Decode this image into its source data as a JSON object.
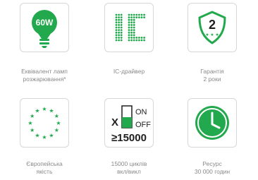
{
  "colors": {
    "green": "#23a94d",
    "dark": "#1e1e1e",
    "border": "#d7d7d7",
    "caption": "#8a8a8a"
  },
  "features": [
    {
      "icon": "led-bulb-icon",
      "badge": "60W",
      "caption_lines": [
        "Еквівалент ламп",
        "розжарювання*"
      ]
    },
    {
      "icon": "ic-driver-icon",
      "caption_lines": [
        "IC-драйвер"
      ]
    },
    {
      "icon": "warranty-shield-icon",
      "badge": "2",
      "caption_lines": [
        "Гарантія",
        "2 роки"
      ]
    },
    {
      "icon": "eu-stars-icon",
      "caption_lines": [
        "Європейська",
        "якість"
      ]
    },
    {
      "icon": "on-off-switch-icon",
      "on_label": "ON",
      "off_label": "OFF",
      "cross": "X",
      "count_label": "≥15000",
      "caption_lines": [
        "15000 циклів",
        "вкл/викл"
      ]
    },
    {
      "icon": "clock-icon",
      "caption_lines": [
        "Ресурс",
        "30 000 годин"
      ]
    }
  ]
}
